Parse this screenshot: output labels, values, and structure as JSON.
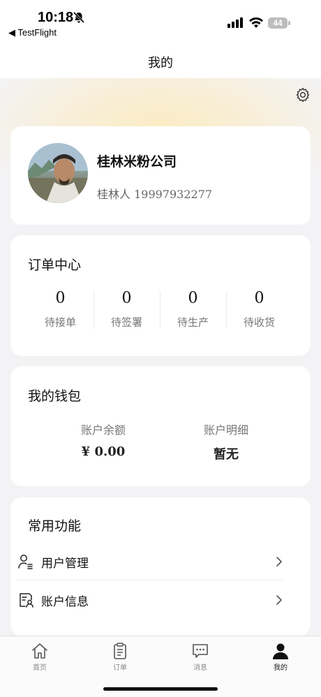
{
  "status_bar": {
    "time": "10:18",
    "back_app": "◀ TestFlight",
    "battery": "44"
  },
  "nav": {
    "title": "我的"
  },
  "profile": {
    "company": "桂林米粉公司",
    "contact": "桂林人 19997932277"
  },
  "orders": {
    "title": "订单中心",
    "items": [
      {
        "count": "0",
        "label": "待接单"
      },
      {
        "count": "0",
        "label": "待签署"
      },
      {
        "count": "0",
        "label": "待生产"
      },
      {
        "count": "0",
        "label": "待收货"
      }
    ]
  },
  "wallet": {
    "title": "我的钱包",
    "balance_label": "账户余额",
    "balance_value": "¥ 0.00",
    "detail_label": "账户明细",
    "detail_value": "暂无"
  },
  "functions": {
    "title": "常用功能",
    "items": [
      {
        "label": "用户管理",
        "icon": "user-manage-icon"
      },
      {
        "label": "账户信息",
        "icon": "account-info-icon"
      }
    ]
  },
  "tabbar": {
    "items": [
      {
        "label": "首页",
        "icon": "home-icon",
        "active": false
      },
      {
        "label": "订单",
        "icon": "clipboard-icon",
        "active": false
      },
      {
        "label": "消息",
        "icon": "message-icon",
        "active": false
      },
      {
        "label": "我的",
        "icon": "person-icon",
        "active": true
      }
    ]
  },
  "colors": {
    "background": "#f3f3f5",
    "card": "#ffffff",
    "header_glow": "#fbecc4",
    "text_primary": "#111111",
    "text_secondary": "#777777"
  }
}
